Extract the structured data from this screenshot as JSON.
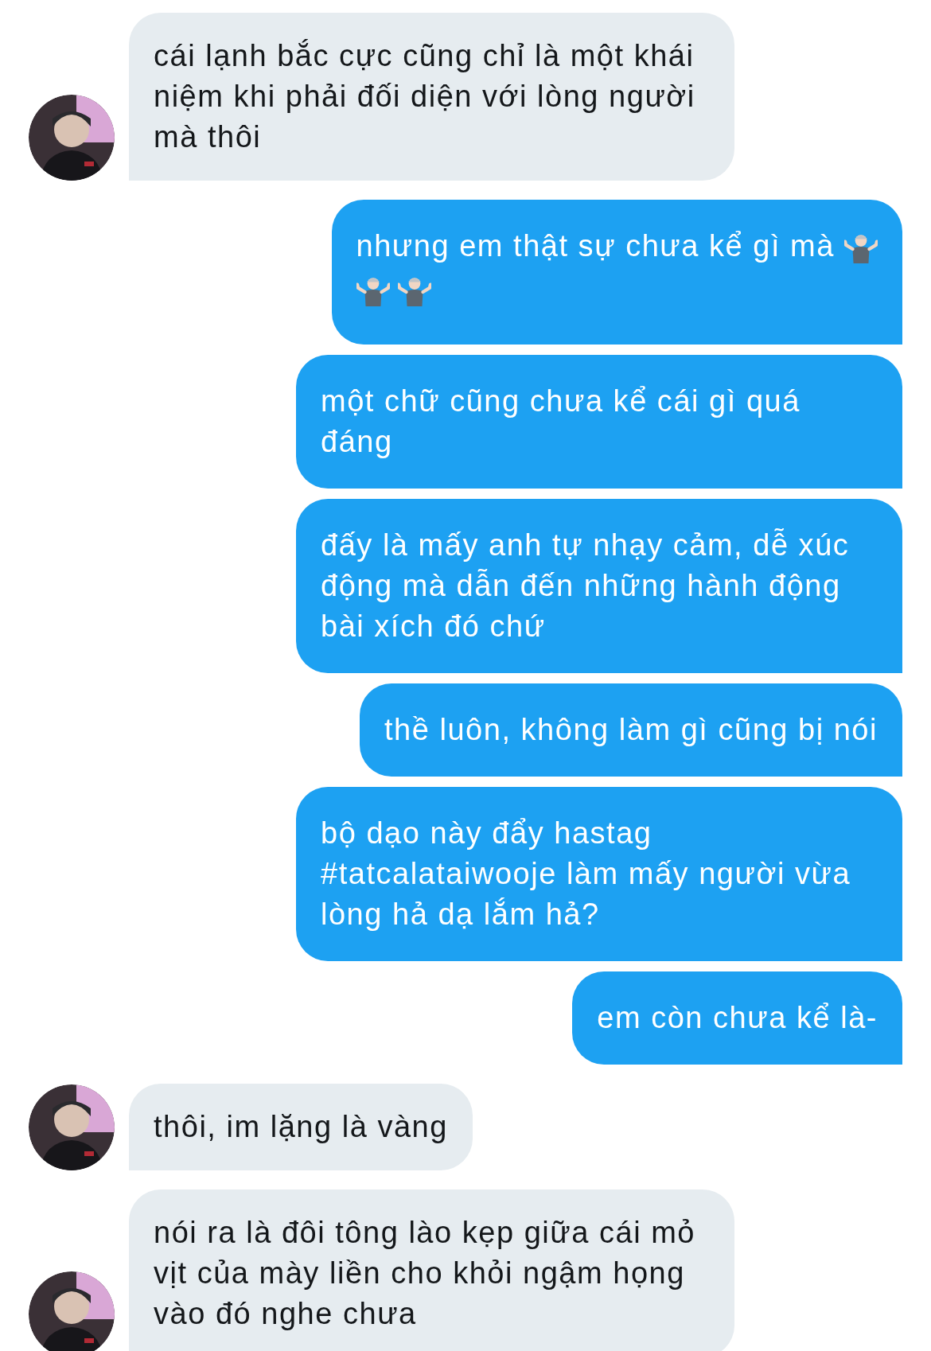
{
  "messages": [
    {
      "kind": "received",
      "text": "cái lạnh bắc cực cũng chỉ là một khái niệm khi phải đối diện với lòng người mà thôi"
    },
    {
      "kind": "sent_with_shrugs",
      "text": "nhưng em thật sự chưa kể gì mà"
    },
    {
      "kind": "sent",
      "text": "một chữ cũng chưa kể cái gì quá đáng"
    },
    {
      "kind": "sent",
      "text": "đấy là mấy anh tự nhạy cảm, dễ xúc động mà dẫn đến những hành động bài xích đó chứ"
    },
    {
      "kind": "sent",
      "text": "thề luôn, không làm gì cũng bị nói"
    },
    {
      "kind": "sent",
      "text": "bộ dạo này đẩy hastag #tatcalataiwooje làm mấy người vừa lòng hả dạ lắm hả?"
    },
    {
      "kind": "sent",
      "text": "em còn chưa kể là-"
    },
    {
      "kind": "received",
      "text": "thôi, im lặng là vàng"
    },
    {
      "kind": "received",
      "text": "nói ra là đôi tông lào kẹp giữa cái mỏ vịt của mày liền cho khỏi ngậm họng vào đó nghe chưa"
    }
  ]
}
